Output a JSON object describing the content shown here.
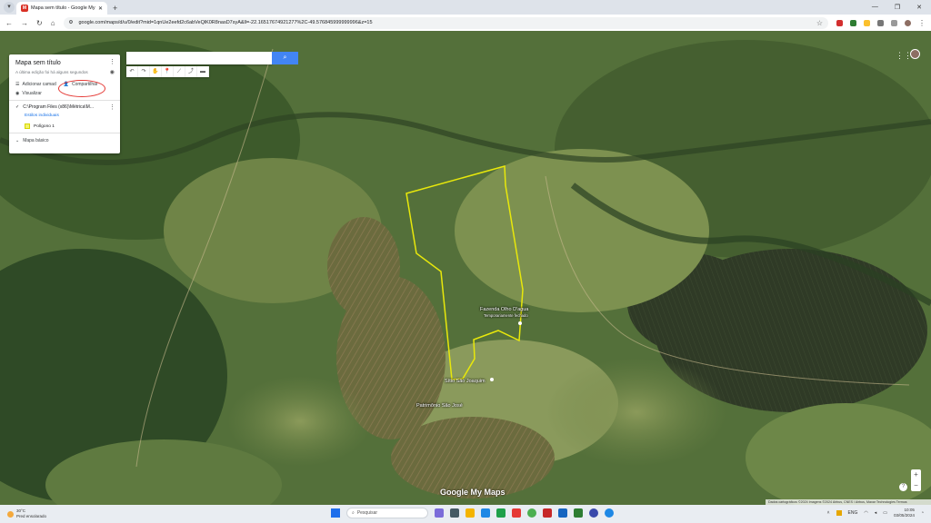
{
  "browser": {
    "tab_title": "Mapa sem título - Google My M",
    "tab_favicon_letter": "M",
    "url": "google.com/maps/d/u/0/edit?mid=1qnUe2eefd2c6abVeQlK0R8nasD7syA&ll=-22.16517674921277%2C-49.576845999999996&z=15"
  },
  "panel": {
    "title": "Mapa sem título",
    "subtitle": "A última edição foi há alguns segundos",
    "add_layer": "Adicionar camad",
    "share": "Compartilhar",
    "preview": "Visualizar",
    "layer_name": "C:\\Program Files (x86)\\Métrica\\M...",
    "layer_style": "Estilos individuais",
    "polygon": "Polígono 1",
    "base_map": "Mapa básico"
  },
  "search": {
    "button_icon": "search-icon"
  },
  "map": {
    "labels": {
      "fazenda": "Fazenda Olho D'agua",
      "fazenda_sub": "Temporariamente fechado",
      "sitio": "Sítio São Joaquim",
      "patrimonio": "Patrimônio São José"
    },
    "logo": "Google My Maps",
    "attribution": "Dados cartográficos ©2024 Imagens ©2024 Airbus, CNES / Airbus, Maxar Technologies   Termos",
    "polygon_color": "#e8e80b"
  },
  "taskbar": {
    "temperature": "30°C",
    "weather": "Pred ensolarado",
    "search_placeholder": "Pesquisar",
    "lang": "ENG",
    "time": "10:05",
    "date": "03/05/2024"
  }
}
